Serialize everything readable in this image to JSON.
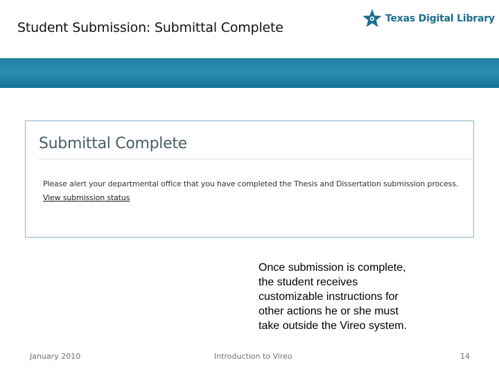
{
  "header": {
    "title": "Student Submission: Submittal Complete",
    "logo_text": "Texas Digital Library",
    "brand_color": "#1b6e8c",
    "banner_color": "#1f7fa3"
  },
  "screenshot": {
    "heading": "Submittal Complete",
    "alert_text": "Please alert your departmental office that you have completed the Thesis and Dissertation submission process.",
    "status_link": "View submission status"
  },
  "callout": {
    "text": "Once submission is complete,\nthe student receives\ncustomizable instructions for\nother actions he or she must\ntake outside the Vireo system."
  },
  "footer": {
    "date": "January 2010",
    "center": "Introduction to Vireo",
    "page_number": "14"
  },
  "icons": {
    "logo": "star-icon"
  }
}
